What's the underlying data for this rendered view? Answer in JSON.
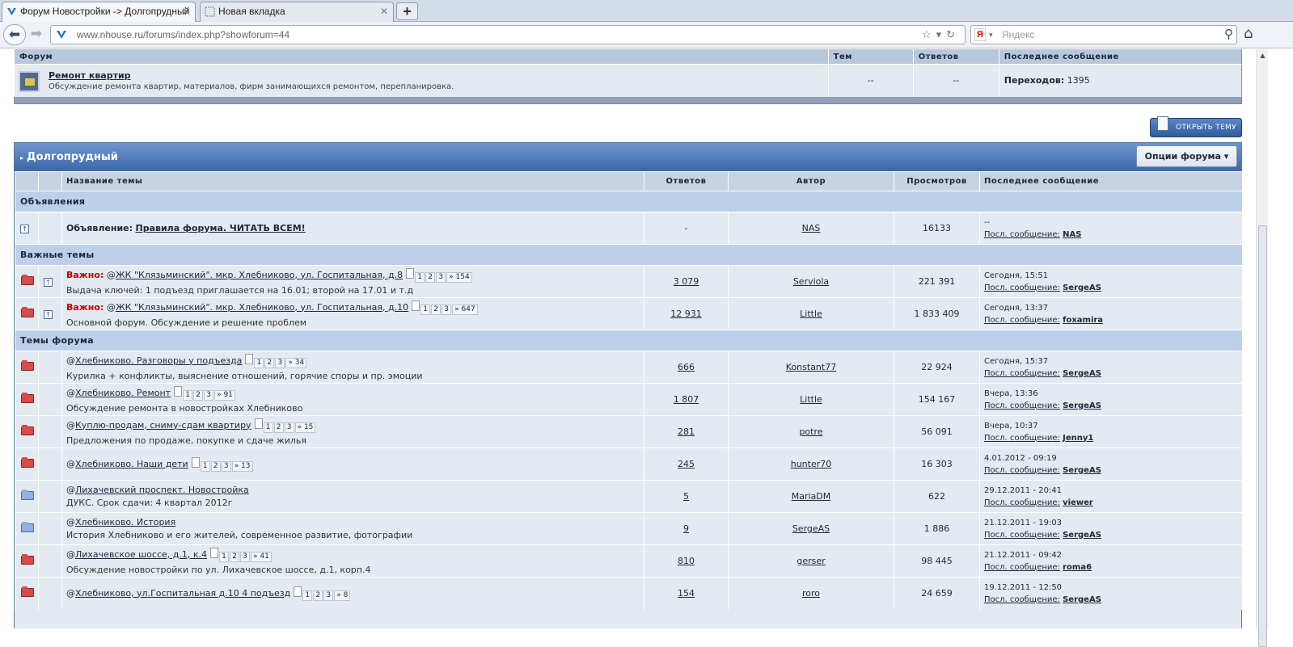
{
  "browser": {
    "tabs": [
      {
        "title": "Форум Новостройки -> Долгопрудный",
        "active": true
      },
      {
        "title": "Новая вкладка",
        "active": false
      }
    ],
    "url_domain": "www.nhouse.ru",
    "url_path": "/forums/index.php?showforum=44",
    "search_placeholder": "Яндекс"
  },
  "subforum": {
    "headers": [
      "Форум",
      "Тем",
      "Ответов",
      "Последнее сообщение"
    ],
    "name": "Ремонт квартир",
    "description": "Обсуждение ремонта квартир, материалов, фирм занимающихся ремонтом, перепланировка.",
    "topics": "--",
    "replies": "--",
    "transitions_label": "Переходов:",
    "transitions_value": "1395"
  },
  "new_topic_label": "ОТКРЫТЬ ТЕМУ",
  "forum": {
    "title": "Долгопрудный",
    "options_label": "Опции форума ▾",
    "headers": [
      "Название темы",
      "Ответов",
      "Автор",
      "Просмотров",
      "Последнее сообщение"
    ]
  },
  "sections": {
    "announcements": "Объявления",
    "important": "Важные темы",
    "topics": "Темы форума"
  },
  "announcement": {
    "prefix": "Объявление:",
    "title": "Правила форума. ЧИТАТЬ ВСЕМ!",
    "replies": "-",
    "author": "NAS",
    "views": "16133",
    "last_line1": "--",
    "last_label": "Посл. сообщение:",
    "last_by": "NAS"
  },
  "important_prefix": "Важно:",
  "pinned": [
    {
      "title": "ЖК \"Клязьминский\". мкр. Хлебниково, ул. Госпитальная, д.8",
      "pages": [
        "1",
        "2",
        "3",
        "» 154"
      ],
      "desc": "Выдача ключей: 1 подъезд приглашается на 16.01; второй на 17.01 и т.д",
      "replies": "3 079",
      "author": "Serviola",
      "views": "221 391",
      "last_date": "Сегодня, 15:51",
      "last_label": "Посл. сообщение:",
      "last_by": "SergeAS"
    },
    {
      "title": "ЖК \"Клязьминский\". мкр. Хлебниково, ул. Госпитальная, д.10",
      "pages": [
        "1",
        "2",
        "3",
        "» 647"
      ],
      "desc": "Основной форум. Обсуждение и решение проблем",
      "replies": "12 931",
      "author": "Little",
      "views": "1 833 409",
      "last_date": "Сегодня, 13:37",
      "last_label": "Посл. сообщение:",
      "last_by": "foxamira"
    }
  ],
  "topics": [
    {
      "title": "Хлебниково. Разговоры у подъезда",
      "pages": [
        "1",
        "2",
        "3",
        "» 34"
      ],
      "desc": "Курилка + конфликты, выяснение отношений, горячие споры и пр. эмоции",
      "replies": "666",
      "author": "Konstant77",
      "views": "22 924",
      "last_date": "Сегодня, 15:37",
      "last_label": "Посл. сообщение:",
      "last_by": "SergeAS",
      "icon": "red"
    },
    {
      "title": "Хлебниково. Ремонт",
      "pages": [
        "1",
        "2",
        "3",
        "» 91"
      ],
      "desc": "Обсуждение ремонта в новостройках Хлебниково",
      "replies": "1 807",
      "author": "Little",
      "views": "154 167",
      "last_date": "Вчера, 13:36",
      "last_label": "Посл. сообщение:",
      "last_by": "SergeAS",
      "icon": "red"
    },
    {
      "title": "Куплю-продам, сниму-сдам квартиру",
      "pages": [
        "1",
        "2",
        "3",
        "» 15"
      ],
      "desc": "Предложения по продаже, покупке и сдаче жилья",
      "replies": "281",
      "author": "potre",
      "views": "56 091",
      "last_date": "Вчера, 10:37",
      "last_label": "Посл. сообщение:",
      "last_by": "Jenny1",
      "icon": "red"
    },
    {
      "title": "Хлебниково. Наши дети",
      "pages": [
        "1",
        "2",
        "3",
        "» 13"
      ],
      "desc": "",
      "replies": "245",
      "author": "hunter70",
      "views": "16 303",
      "last_date": "4.01.2012 - 09:19",
      "last_label": "Посл. сообщение:",
      "last_by": "SergeAS",
      "icon": "red"
    },
    {
      "title": "Лихачевский проспект. Новостройка",
      "pages": [],
      "desc": "ДУКС. Срок сдачи: 4 квартал 2012г",
      "replies": "5",
      "author": "MariaDM",
      "views": "622",
      "last_date": "29.12.2011 - 20:41",
      "last_label": "Посл. сообщение:",
      "last_by": "viewer",
      "icon": "blue"
    },
    {
      "title": "Хлебниково. История",
      "pages": [],
      "desc": "История Хлебниково и его жителей, современное развитие, фотографии",
      "replies": "9",
      "author": "SergeAS",
      "views": "1 886",
      "last_date": "21.12.2011 - 19:03",
      "last_label": "Посл. сообщение:",
      "last_by": "SergeAS",
      "icon": "blue"
    },
    {
      "title": "Лихачевское шоссе, д.1, к.4",
      "pages": [
        "1",
        "2",
        "3",
        "» 41"
      ],
      "desc": "Обсуждение новостройки по ул. Лихачевское шоссе, д.1, корп.4",
      "replies": "810",
      "author": "gerser",
      "views": "98 445",
      "last_date": "21.12.2011 - 09:42",
      "last_label": "Посл. сообщение:",
      "last_by": "roma6",
      "icon": "red"
    },
    {
      "title": "Хлебниково, ул.Госпитальная д.10 4 подъезд",
      "pages": [
        "1",
        "2",
        "3",
        "» 8"
      ],
      "desc": "",
      "replies": "154",
      "author": "roro",
      "views": "24 659",
      "last_date": "19.12.2011 - 12:50",
      "last_label": "Посл. сообщение:",
      "last_by": "SergeAS",
      "icon": "red"
    }
  ]
}
